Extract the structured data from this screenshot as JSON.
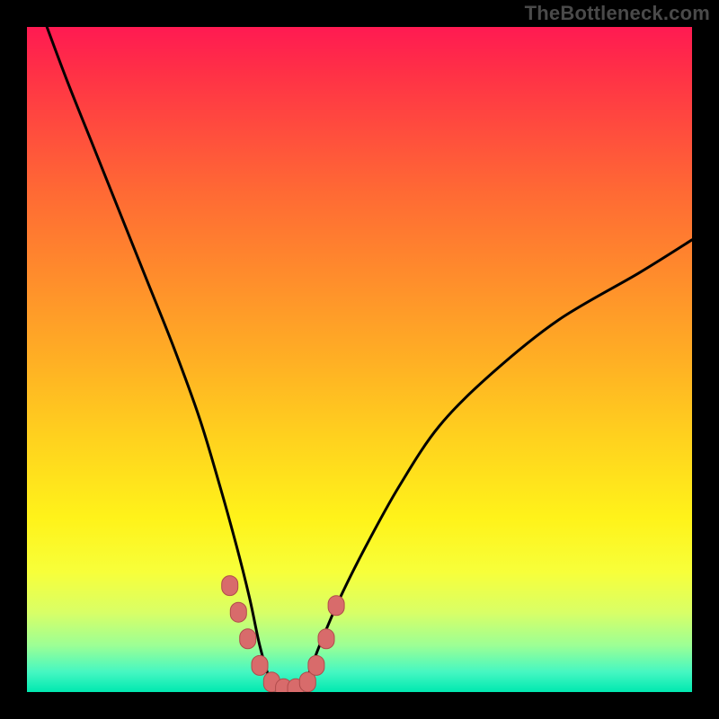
{
  "watermark": {
    "text": "TheBottleneck.com"
  },
  "colors": {
    "frame_bg": "#000000",
    "gradient_top": "#ff1a52",
    "gradient_bottom": "#00e8b0",
    "curve_stroke": "#000000",
    "marker_fill": "#d86b6b",
    "marker_stroke": "#b04b4b"
  },
  "chart_data": {
    "type": "line",
    "title": "",
    "xlabel": "",
    "ylabel": "",
    "xlim": [
      0,
      100
    ],
    "ylim": [
      0,
      100
    ],
    "series": [
      {
        "name": "bottleneck-curve",
        "x": [
          3,
          6,
          10,
          14,
          18,
          22,
          26,
          29,
          31.5,
          33.5,
          35,
          36.5,
          38,
          40,
          42,
          44,
          47,
          51,
          56,
          62,
          70,
          80,
          92,
          100
        ],
        "y": [
          100,
          92,
          82,
          72,
          62,
          52,
          41,
          31,
          22,
          14,
          7,
          2,
          0,
          0,
          2,
          7,
          14,
          22,
          31,
          40,
          48,
          56,
          63,
          68
        ]
      }
    ],
    "markers": {
      "name": "highlighted-points",
      "x": [
        30.5,
        31.8,
        33.2,
        35,
        36.8,
        38.6,
        40.4,
        42.2,
        43.5,
        45,
        46.5
      ],
      "y": [
        16,
        12,
        8,
        4,
        1.5,
        0.5,
        0.5,
        1.5,
        4,
        8,
        13
      ]
    }
  }
}
